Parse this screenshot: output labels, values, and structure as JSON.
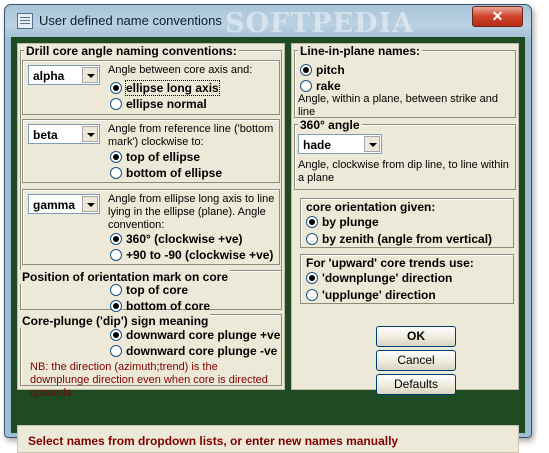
{
  "window": {
    "title": "User defined name conventions",
    "watermark": "SOFTPEDIA",
    "close_label": "✕"
  },
  "drill_core": {
    "title": "Drill core angle naming conventions:",
    "alpha": {
      "value": "alpha",
      "description": "Angle between core axis and:",
      "options": [
        "ellipse long axis",
        "ellipse normal"
      ],
      "selected": 0
    },
    "beta": {
      "value": "beta",
      "description": "Angle from reference line ('bottom mark') clockwise to:",
      "options": [
        "top of ellipse",
        "bottom of ellipse"
      ],
      "selected": 0
    },
    "gamma": {
      "value": "gamma",
      "description": "Angle from ellipse long axis to line lying in the ellipse (plane). Angle convention:",
      "options": [
        "360° (clockwise +ve)",
        "+90 to -90 (clockwise +ve)"
      ],
      "selected": 0
    }
  },
  "orientation_mark": {
    "title": "Position of orientation mark on core",
    "options": [
      "top of core",
      "bottom of core"
    ],
    "selected": 1
  },
  "core_plunge": {
    "title": "Core-plunge ('dip') sign meaning",
    "options": [
      "downward core plunge +ve",
      "downward core plunge -ve"
    ],
    "selected": 0,
    "note": "NB: the direction (azimuth;trend) is the downplunge direction even when core is directed upwards"
  },
  "line_in_plane": {
    "title": "Line-in-plane names:",
    "options": [
      "pitch",
      "rake"
    ],
    "selected": 0,
    "description": "Angle, within a plane, between strike and line"
  },
  "angle_360": {
    "title": "360° angle",
    "value": "hade",
    "description": "Angle, clockwise from dip line, to line within a plane"
  },
  "core_orientation": {
    "title": "core orientation given:",
    "options": [
      "by plunge",
      "by zenith (angle from vertical)"
    ],
    "selected": 0
  },
  "upward_core": {
    "title": "For 'upward' core trends use:",
    "options": [
      "'downplunge' direction",
      "'upplunge' direction"
    ],
    "selected": 0
  },
  "buttons": {
    "ok": "OK",
    "cancel": "Cancel",
    "defaults": "Defaults"
  },
  "status": "Select names from dropdown lists, or enter new names manually"
}
